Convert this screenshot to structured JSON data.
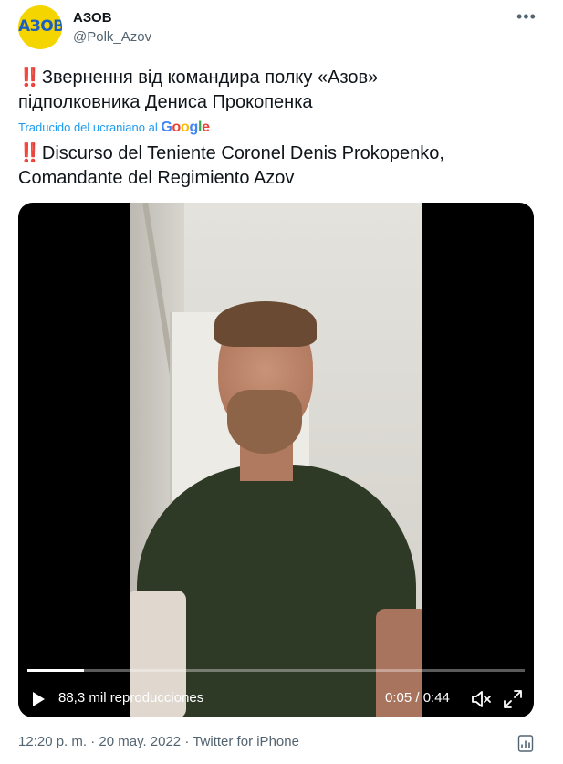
{
  "account": {
    "display_name": "АЗОВ",
    "handle": "@Polk_Azov",
    "avatar_text": "АЗОВ"
  },
  "icons": {
    "more": "more-dots-icon",
    "play": "play-icon",
    "mute": "mute-icon",
    "fullscreen": "fullscreen-icon",
    "analytics": "analytics-icon"
  },
  "tweet": {
    "emoji": "‼️",
    "original_line1": "Звернення від командира полку «Азов»",
    "original_line2": "підполковника Дениса Прокопенка",
    "translated_by_prefix": "Traducido del ucraniano al",
    "translated_by_brand": "Google",
    "translation_line1": "Discurso del Teniente Coronel Denis Prokopenko,",
    "translation_line2": "Comandante del Regimiento Azov"
  },
  "video": {
    "views": "88,3 mil reproducciones",
    "current_time": "0:05",
    "duration": "0:44",
    "time_display": "0:05 / 0:44",
    "progress": 0.114
  },
  "meta": {
    "timestamp": "12:20 p. m. · 20 may. 2022 · Twitter for iPhone"
  },
  "colors": {
    "accent": "#1d9bf0",
    "text": "#0f1419",
    "muted": "#536471",
    "avatar_bg": "#f5d500",
    "avatar_fg": "#1d5fbf"
  }
}
